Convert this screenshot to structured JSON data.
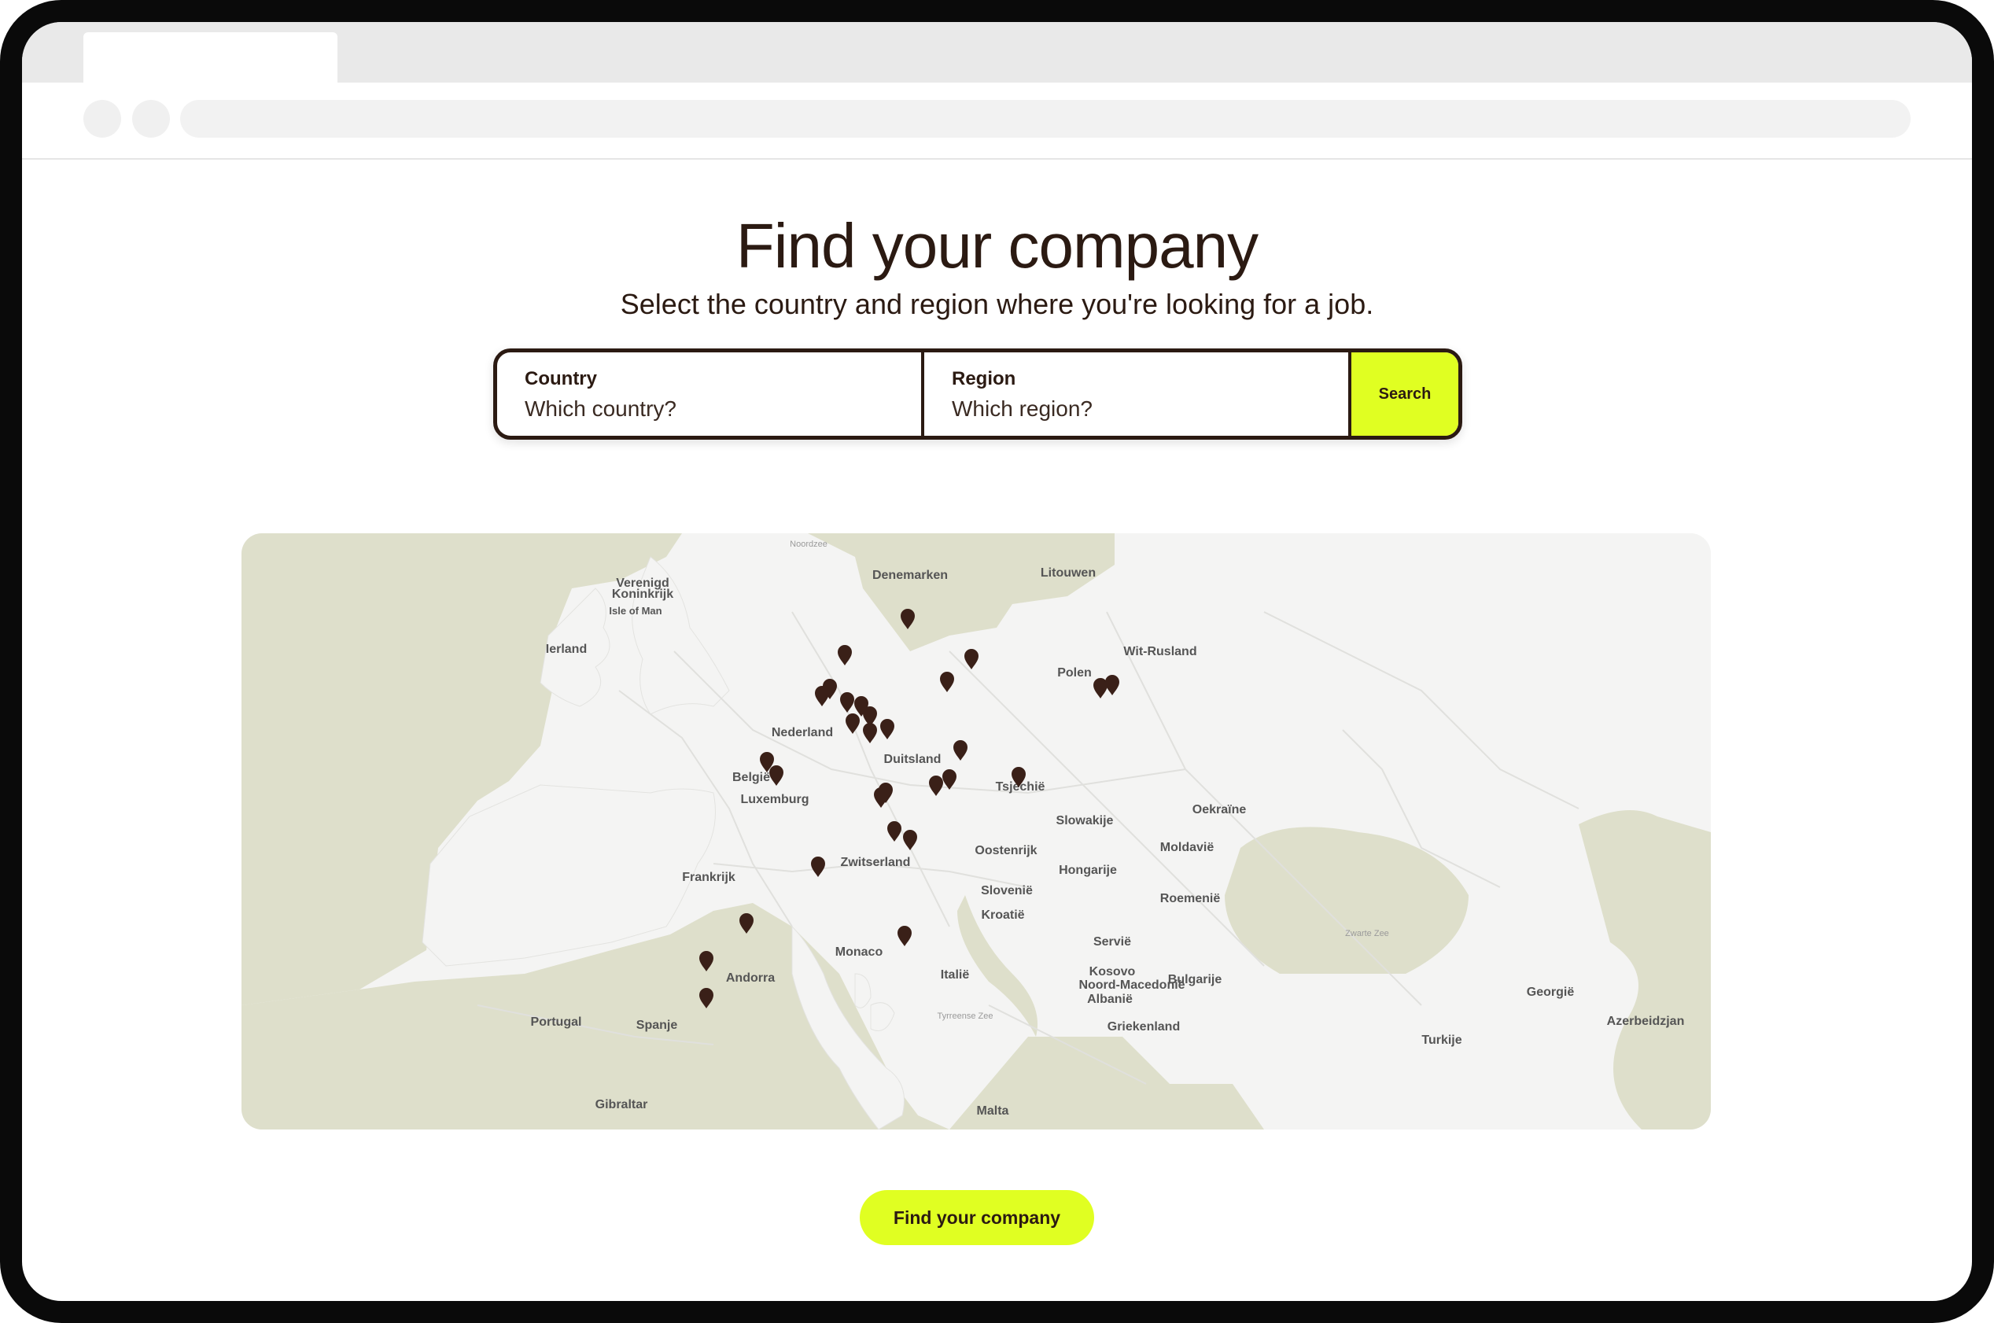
{
  "page": {
    "title": "Find your company",
    "subtitle": "Select the country and region where you're looking for a job."
  },
  "search": {
    "country_label": "Country",
    "country_placeholder": "Which country?",
    "region_label": "Region",
    "region_placeholder": "Which region?",
    "button_label": "Search"
  },
  "map": {
    "labels": [
      {
        "text": "Verenigd",
        "kind": "country"
      },
      {
        "text": "Koninkrijk",
        "kind": "country"
      },
      {
        "text": "Isle of Man",
        "kind": "region"
      },
      {
        "text": "Ierland",
        "kind": "country"
      },
      {
        "text": "Noordzee",
        "kind": "sea"
      },
      {
        "text": "Denemarken",
        "kind": "country"
      },
      {
        "text": "Litouwen",
        "kind": "country"
      },
      {
        "text": "Polen",
        "kind": "country"
      },
      {
        "text": "Wit-Rusland",
        "kind": "country"
      },
      {
        "text": "Nederland",
        "kind": "country"
      },
      {
        "text": "Duitsland",
        "kind": "country"
      },
      {
        "text": "België",
        "kind": "country"
      },
      {
        "text": "Luxemburg",
        "kind": "country"
      },
      {
        "text": "Tsjechië",
        "kind": "country"
      },
      {
        "text": "Slowakije",
        "kind": "country"
      },
      {
        "text": "Oekraïne",
        "kind": "country"
      },
      {
        "text": "Oostenrijk",
        "kind": "country"
      },
      {
        "text": "Moldavië",
        "kind": "country"
      },
      {
        "text": "Frankrijk",
        "kind": "country"
      },
      {
        "text": "Zwitserland",
        "kind": "country"
      },
      {
        "text": "Hongarije",
        "kind": "country"
      },
      {
        "text": "Slovenië",
        "kind": "country"
      },
      {
        "text": "Roemenië",
        "kind": "country"
      },
      {
        "text": "Kroatië",
        "kind": "country"
      },
      {
        "text": "Servië",
        "kind": "country"
      },
      {
        "text": "Monaco",
        "kind": "country"
      },
      {
        "text": "Zwarte Zee",
        "kind": "sea"
      },
      {
        "text": "Andorra",
        "kind": "country"
      },
      {
        "text": "Italië",
        "kind": "country"
      },
      {
        "text": "Kosovo",
        "kind": "country"
      },
      {
        "text": "Bulgarije",
        "kind": "country"
      },
      {
        "text": "Georgië",
        "kind": "country"
      },
      {
        "text": "Noord-Macedonië",
        "kind": "country"
      },
      {
        "text": "Albanië",
        "kind": "country"
      },
      {
        "text": "Tyrreense Zee",
        "kind": "sea"
      },
      {
        "text": "Portugal",
        "kind": "country"
      },
      {
        "text": "Spanje",
        "kind": "country"
      },
      {
        "text": "Azerbeidzjan",
        "kind": "country"
      },
      {
        "text": "Griekenland",
        "kind": "country"
      },
      {
        "text": "Turkije",
        "kind": "country"
      },
      {
        "text": "Gibraltar",
        "kind": "country"
      },
      {
        "text": "Malta",
        "kind": "country"
      }
    ],
    "pin_count": 32
  },
  "cta": {
    "label": "Find your company"
  },
  "colors": {
    "accent": "#e0ff22",
    "text": "#2b1a12",
    "sea": "#dedfcb",
    "land": "#f4f4f3",
    "pin": "#3a2018"
  }
}
